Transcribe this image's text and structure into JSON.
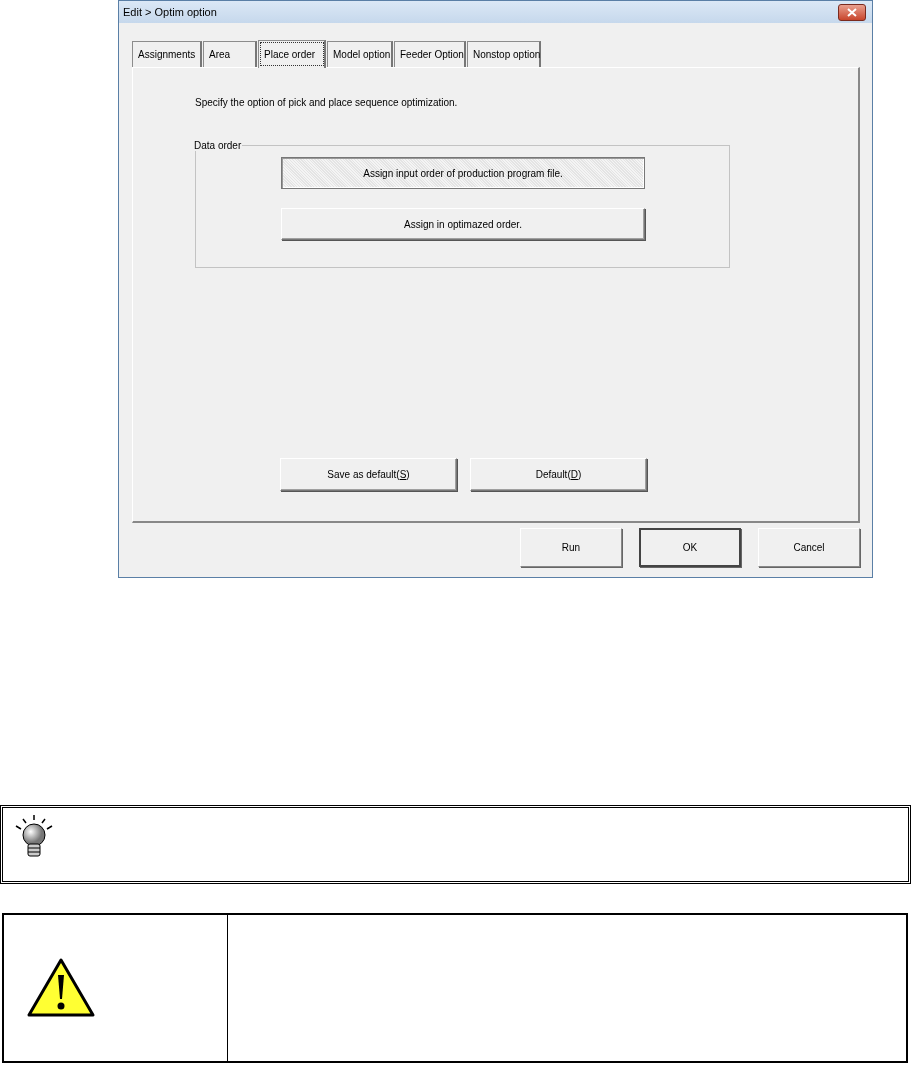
{
  "window": {
    "title": "Edit > Optim option"
  },
  "tabs": [
    {
      "label": "Assignments",
      "selected": false
    },
    {
      "label": "Area",
      "selected": false
    },
    {
      "label": "Place order",
      "selected": true
    },
    {
      "label": "Model option",
      "selected": false
    },
    {
      "label": "Feeder Option",
      "selected": false
    },
    {
      "label": "Nonstop option",
      "selected": false
    }
  ],
  "description": "Specify the option of pick and place sequence optimization.",
  "data_order": {
    "title": "Data order",
    "buttons": [
      {
        "label": "Assign input order of production program file.",
        "pressed": true
      },
      {
        "label": "Assign in optimazed order.",
        "pressed": false
      }
    ]
  },
  "default_buttons": [
    {
      "label_before": "Save as default(",
      "access_key": "S",
      "label_after": ")"
    },
    {
      "label_before": "Default(",
      "access_key": "D",
      "label_after": ")"
    }
  ],
  "dialog_buttons": [
    {
      "label": "Run",
      "default": false
    },
    {
      "label": "OK",
      "default": true
    },
    {
      "label": "Cancel",
      "default": false
    }
  ]
}
